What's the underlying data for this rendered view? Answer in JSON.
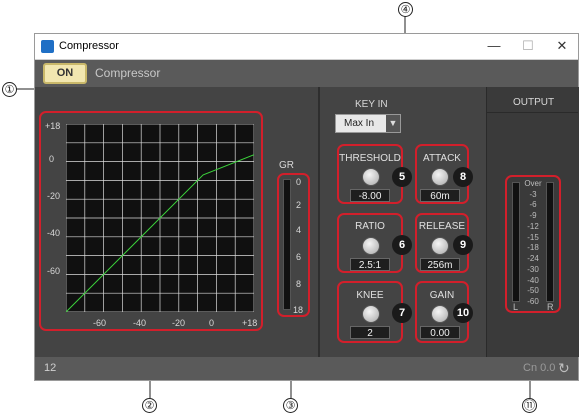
{
  "window": {
    "title": "Compressor",
    "minimize": "—",
    "maximize": "☐",
    "close": "✕"
  },
  "toolbar": {
    "on_label": "ON",
    "title": "Compressor"
  },
  "graph": {
    "y_ticks": [
      "+18",
      "0",
      "-20",
      "-40",
      "-60"
    ],
    "x_ticks": [
      "-60",
      "-40",
      "-20",
      "0",
      "+18"
    ],
    "curve_color": "#3bd23b",
    "chart_data": {
      "type": "line",
      "series": [
        {
          "values": [
            [
              -78,
              -78
            ],
            [
              -8,
              -8
            ],
            [
              18,
              2.3
            ]
          ]
        }
      ],
      "xlim": [
        -78,
        18
      ],
      "ylim": [
        -78,
        18
      ],
      "grid": true
    }
  },
  "gr_meter": {
    "title": "GR",
    "ticks": [
      "0",
      "2",
      "4",
      "6",
      "8",
      "18"
    ]
  },
  "key_in": {
    "label": "KEY IN",
    "value": "Max In",
    "arrow": "▼"
  },
  "knobs": {
    "threshold": {
      "label": "THRESHOLD",
      "value": "-8.00",
      "marker": "5"
    },
    "attack": {
      "label": "ATTACK",
      "value": "60m",
      "marker": "8"
    },
    "ratio": {
      "label": "RATIO",
      "value": "2.5:1",
      "marker": "6"
    },
    "release": {
      "label": "RELEASE",
      "value": "256m",
      "marker": "9"
    },
    "knee": {
      "label": "KNEE",
      "value": "2",
      "marker": "7"
    },
    "gain": {
      "label": "GAIN",
      "value": "0.00",
      "marker": "10"
    }
  },
  "output": {
    "title": "OUTPUT",
    "scale": [
      "Over",
      "-3",
      "-6",
      "-9",
      "-12",
      "-15",
      "-18",
      "-24",
      "-30",
      "-40",
      "-50",
      "-60"
    ],
    "left": "L",
    "right": "R"
  },
  "status": {
    "left": "12",
    "right": "Cn 0.0",
    "refresh_icon": "↻"
  },
  "callouts": [
    "①",
    "②",
    "③",
    "④",
    "⑪"
  ],
  "colors": {
    "highlight": "#d21f2b",
    "on_button": "#f2e7b0"
  }
}
